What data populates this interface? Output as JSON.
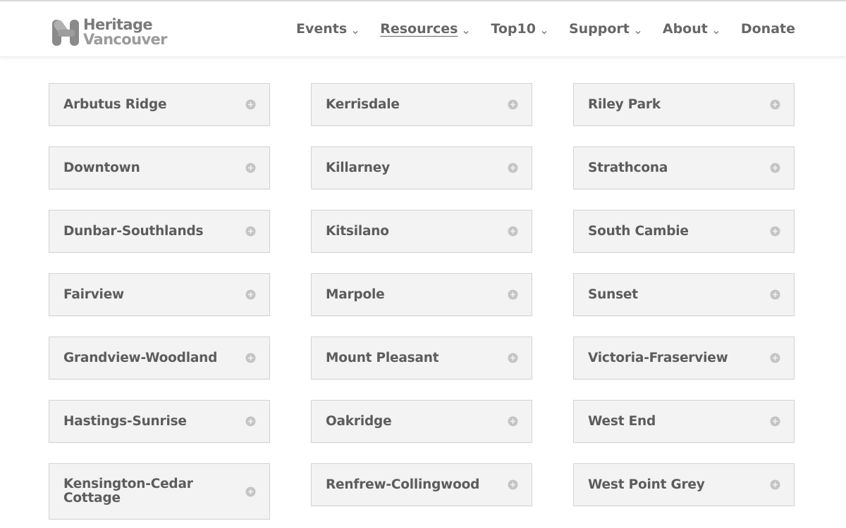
{
  "brand": {
    "line1": "Heritage",
    "line2": "Vancouver",
    "logo_icon": "heritage-vancouver-h-mark"
  },
  "nav": {
    "items": [
      {
        "label": "Events",
        "has_dropdown": true,
        "active": false
      },
      {
        "label": "Resources",
        "has_dropdown": true,
        "active": true
      },
      {
        "label": "Top10",
        "has_dropdown": true,
        "active": false
      },
      {
        "label": "Support",
        "has_dropdown": true,
        "active": false
      },
      {
        "label": "About",
        "has_dropdown": true,
        "active": false
      },
      {
        "label": "Donate",
        "has_dropdown": false,
        "active": false
      }
    ]
  },
  "neighbourhoods": {
    "toggle_icon": "plus-circle-icon",
    "columns": [
      [
        "Arbutus Ridge",
        "Downtown",
        "Dunbar-Southlands",
        "Fairview",
        "Grandview-Woodland",
        "Hastings-Sunrise",
        "Kensington-Cedar Cottage"
      ],
      [
        "Kerrisdale",
        "Killarney",
        "Kitsilano",
        "Marpole",
        "Mount Pleasant",
        "Oakridge",
        "Renfrew-Collingwood"
      ],
      [
        "Riley Park",
        "Strathcona",
        "South Cambie",
        "Sunset",
        "Victoria-Fraserview",
        "West End",
        "West Point Grey"
      ]
    ]
  },
  "colors": {
    "text": "#5c5c5c",
    "card_bg": "#f3f3f3",
    "card_border": "#d3d3d3",
    "icon": "#c4c4c4"
  }
}
